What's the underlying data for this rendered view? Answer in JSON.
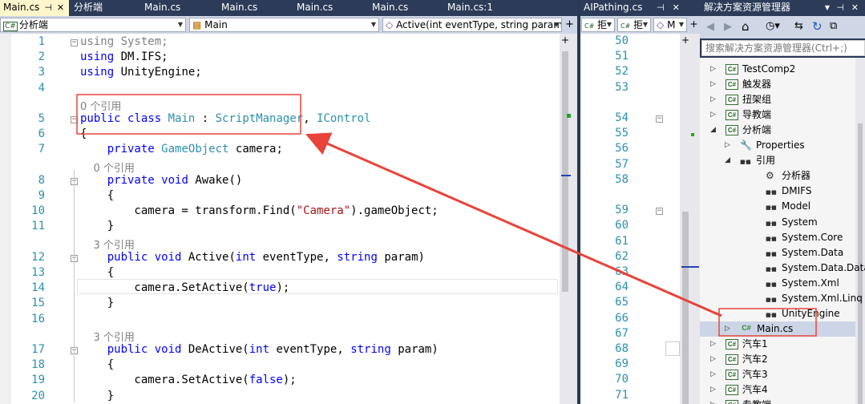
{
  "main_tabs": [
    {
      "label": "Main.cs",
      "active": true
    },
    {
      "label": "分析端"
    },
    {
      "label": "Main.cs"
    },
    {
      "label": "Main.cs"
    },
    {
      "label": "Main.cs"
    },
    {
      "label": "Main.cs"
    },
    {
      "label": "Main.cs:1"
    }
  ],
  "nav": {
    "project": "分析端",
    "class": "Main",
    "member": "Active(int eventType, string param)",
    "cs_badge": "C#"
  },
  "code_lines": [
    {
      "n": "1",
      "parts": [
        {
          "t": "using System;",
          "c": "gr"
        }
      ]
    },
    {
      "n": "2",
      "parts": [
        {
          "t": "using",
          "c": "kw"
        },
        {
          "t": " DM.IFS;"
        }
      ]
    },
    {
      "n": "3",
      "parts": [
        {
          "t": "using",
          "c": "kw"
        },
        {
          "t": " UnityEngine;"
        }
      ]
    },
    {
      "n": "4",
      "parts": []
    },
    {
      "lens": "0 个引用"
    },
    {
      "n": "5",
      "parts": [
        {
          "t": "public",
          "c": "kw"
        },
        {
          "t": " "
        },
        {
          "t": "class",
          "c": "kw"
        },
        {
          "t": " "
        },
        {
          "t": "Main",
          "c": "ty"
        },
        {
          "t": " : "
        },
        {
          "t": "ScriptManager",
          "c": "ty"
        },
        {
          "t": ", "
        },
        {
          "t": "IControl",
          "c": "ty"
        }
      ]
    },
    {
      "n": "6",
      "parts": [
        {
          "t": "{"
        }
      ]
    },
    {
      "n": "7",
      "parts": [
        {
          "t": "    "
        },
        {
          "t": "private",
          "c": "kw"
        },
        {
          "t": " "
        },
        {
          "t": "GameObject",
          "c": "ty"
        },
        {
          "t": " camera;"
        }
      ]
    },
    {
      "lens": "    0 个引用"
    },
    {
      "n": "8",
      "parts": [
        {
          "t": "    "
        },
        {
          "t": "private",
          "c": "kw"
        },
        {
          "t": " "
        },
        {
          "t": "void",
          "c": "kw"
        },
        {
          "t": " Awake()"
        }
      ]
    },
    {
      "n": "9",
      "parts": [
        {
          "t": "    {"
        }
      ]
    },
    {
      "n": "10",
      "parts": [
        {
          "t": "        camera = transform.Find("
        },
        {
          "t": "\"Camera\"",
          "c": "st"
        },
        {
          "t": ").gameObject;"
        }
      ]
    },
    {
      "n": "11",
      "parts": [
        {
          "t": "    }"
        }
      ]
    },
    {
      "lens": "    3 个引用"
    },
    {
      "n": "12",
      "parts": [
        {
          "t": "    "
        },
        {
          "t": "public",
          "c": "kw"
        },
        {
          "t": " "
        },
        {
          "t": "void",
          "c": "kw"
        },
        {
          "t": " Active("
        },
        {
          "t": "int",
          "c": "kw"
        },
        {
          "t": " eventType, "
        },
        {
          "t": "string",
          "c": "kw"
        },
        {
          "t": " param)"
        }
      ]
    },
    {
      "n": "13",
      "parts": [
        {
          "t": "    {"
        }
      ]
    },
    {
      "n": "14",
      "parts": [
        {
          "t": "        camera.SetActive("
        },
        {
          "t": "true",
          "c": "kw"
        },
        {
          "t": ");"
        }
      ]
    },
    {
      "n": "15",
      "parts": [
        {
          "t": "    }"
        }
      ]
    },
    {
      "n": "16",
      "parts": []
    },
    {
      "lens": "    3 个引用"
    },
    {
      "n": "17",
      "parts": [
        {
          "t": "    "
        },
        {
          "t": "public",
          "c": "kw"
        },
        {
          "t": " "
        },
        {
          "t": "void",
          "c": "kw"
        },
        {
          "t": " DeActive("
        },
        {
          "t": "int",
          "c": "kw"
        },
        {
          "t": " eventType, "
        },
        {
          "t": "string",
          "c": "kw"
        },
        {
          "t": " param)"
        }
      ]
    },
    {
      "n": "18",
      "parts": [
        {
          "t": "    {"
        }
      ]
    },
    {
      "n": "19",
      "parts": [
        {
          "t": "        camera.SetActive("
        },
        {
          "t": "false",
          "c": "kw"
        },
        {
          "t": ");"
        }
      ]
    },
    {
      "n": "20",
      "parts": [
        {
          "t": "    }"
        }
      ]
    }
  ],
  "second_editor": {
    "tab": "AIPathing.cs",
    "nav1": "拒",
    "nav2": "拒",
    "nav3": "M",
    "line_numbers": [
      "50",
      "51",
      "52",
      "53",
      "",
      "54",
      "55",
      "56",
      "57",
      "58",
      "",
      "59",
      "60",
      "61",
      "62",
      "63",
      "64",
      "65",
      "66",
      "67",
      "68",
      "69",
      "70",
      "71"
    ]
  },
  "solution_explorer": {
    "title": "解决方案资源管理器",
    "search_placeholder": "搜索解决方案资源管理器(Ctrl+;)",
    "nodes": [
      {
        "label": "TestComp2",
        "kind": "proj",
        "indent": 0,
        "exp": "▷"
      },
      {
        "label": "触发器",
        "kind": "proj",
        "indent": 0,
        "exp": "▷"
      },
      {
        "label": "扭架组",
        "kind": "proj",
        "indent": 0,
        "exp": "▷"
      },
      {
        "label": "导教端",
        "kind": "proj",
        "indent": 0,
        "exp": "▷"
      },
      {
        "label": "分析端",
        "kind": "proj",
        "indent": 0,
        "exp": "◢"
      },
      {
        "label": "Properties",
        "kind": "wrench",
        "indent": 1,
        "exp": "▷"
      },
      {
        "label": "引用",
        "kind": "ref",
        "indent": 1,
        "exp": "◢"
      },
      {
        "label": "分析器",
        "kind": "analyzer",
        "indent": 2
      },
      {
        "label": "DMIFS",
        "kind": "ref",
        "indent": 2
      },
      {
        "label": "Model",
        "kind": "ref",
        "indent": 2
      },
      {
        "label": "System",
        "kind": "ref",
        "indent": 2
      },
      {
        "label": "System.Core",
        "kind": "ref",
        "indent": 2
      },
      {
        "label": "System.Data",
        "kind": "ref",
        "indent": 2
      },
      {
        "label": "System.Data.DataS",
        "kind": "ref",
        "indent": 2
      },
      {
        "label": "System.Xml",
        "kind": "ref",
        "indent": 2
      },
      {
        "label": "System.Xml.Linq",
        "kind": "ref",
        "indent": 2
      },
      {
        "label": "UnityEngine",
        "kind": "ref",
        "indent": 2
      },
      {
        "label": "Main.cs",
        "kind": "cs",
        "indent": 1,
        "exp": "▷",
        "selected": true
      },
      {
        "label": "汽车1",
        "kind": "proj",
        "indent": 0,
        "exp": "▷"
      },
      {
        "label": "汽车2",
        "kind": "proj",
        "indent": 0,
        "exp": "▷"
      },
      {
        "label": "汽车3",
        "kind": "proj",
        "indent": 0,
        "exp": "▷"
      },
      {
        "label": "汽车4",
        "kind": "proj",
        "indent": 0,
        "exp": "▷"
      },
      {
        "label": "专教端",
        "kind": "proj",
        "indent": 0,
        "exp": "▷"
      }
    ]
  },
  "colors": {
    "annotation": "#e8443a",
    "keyword": "#0000ff",
    "type": "#2b91af",
    "string": "#a31515"
  }
}
